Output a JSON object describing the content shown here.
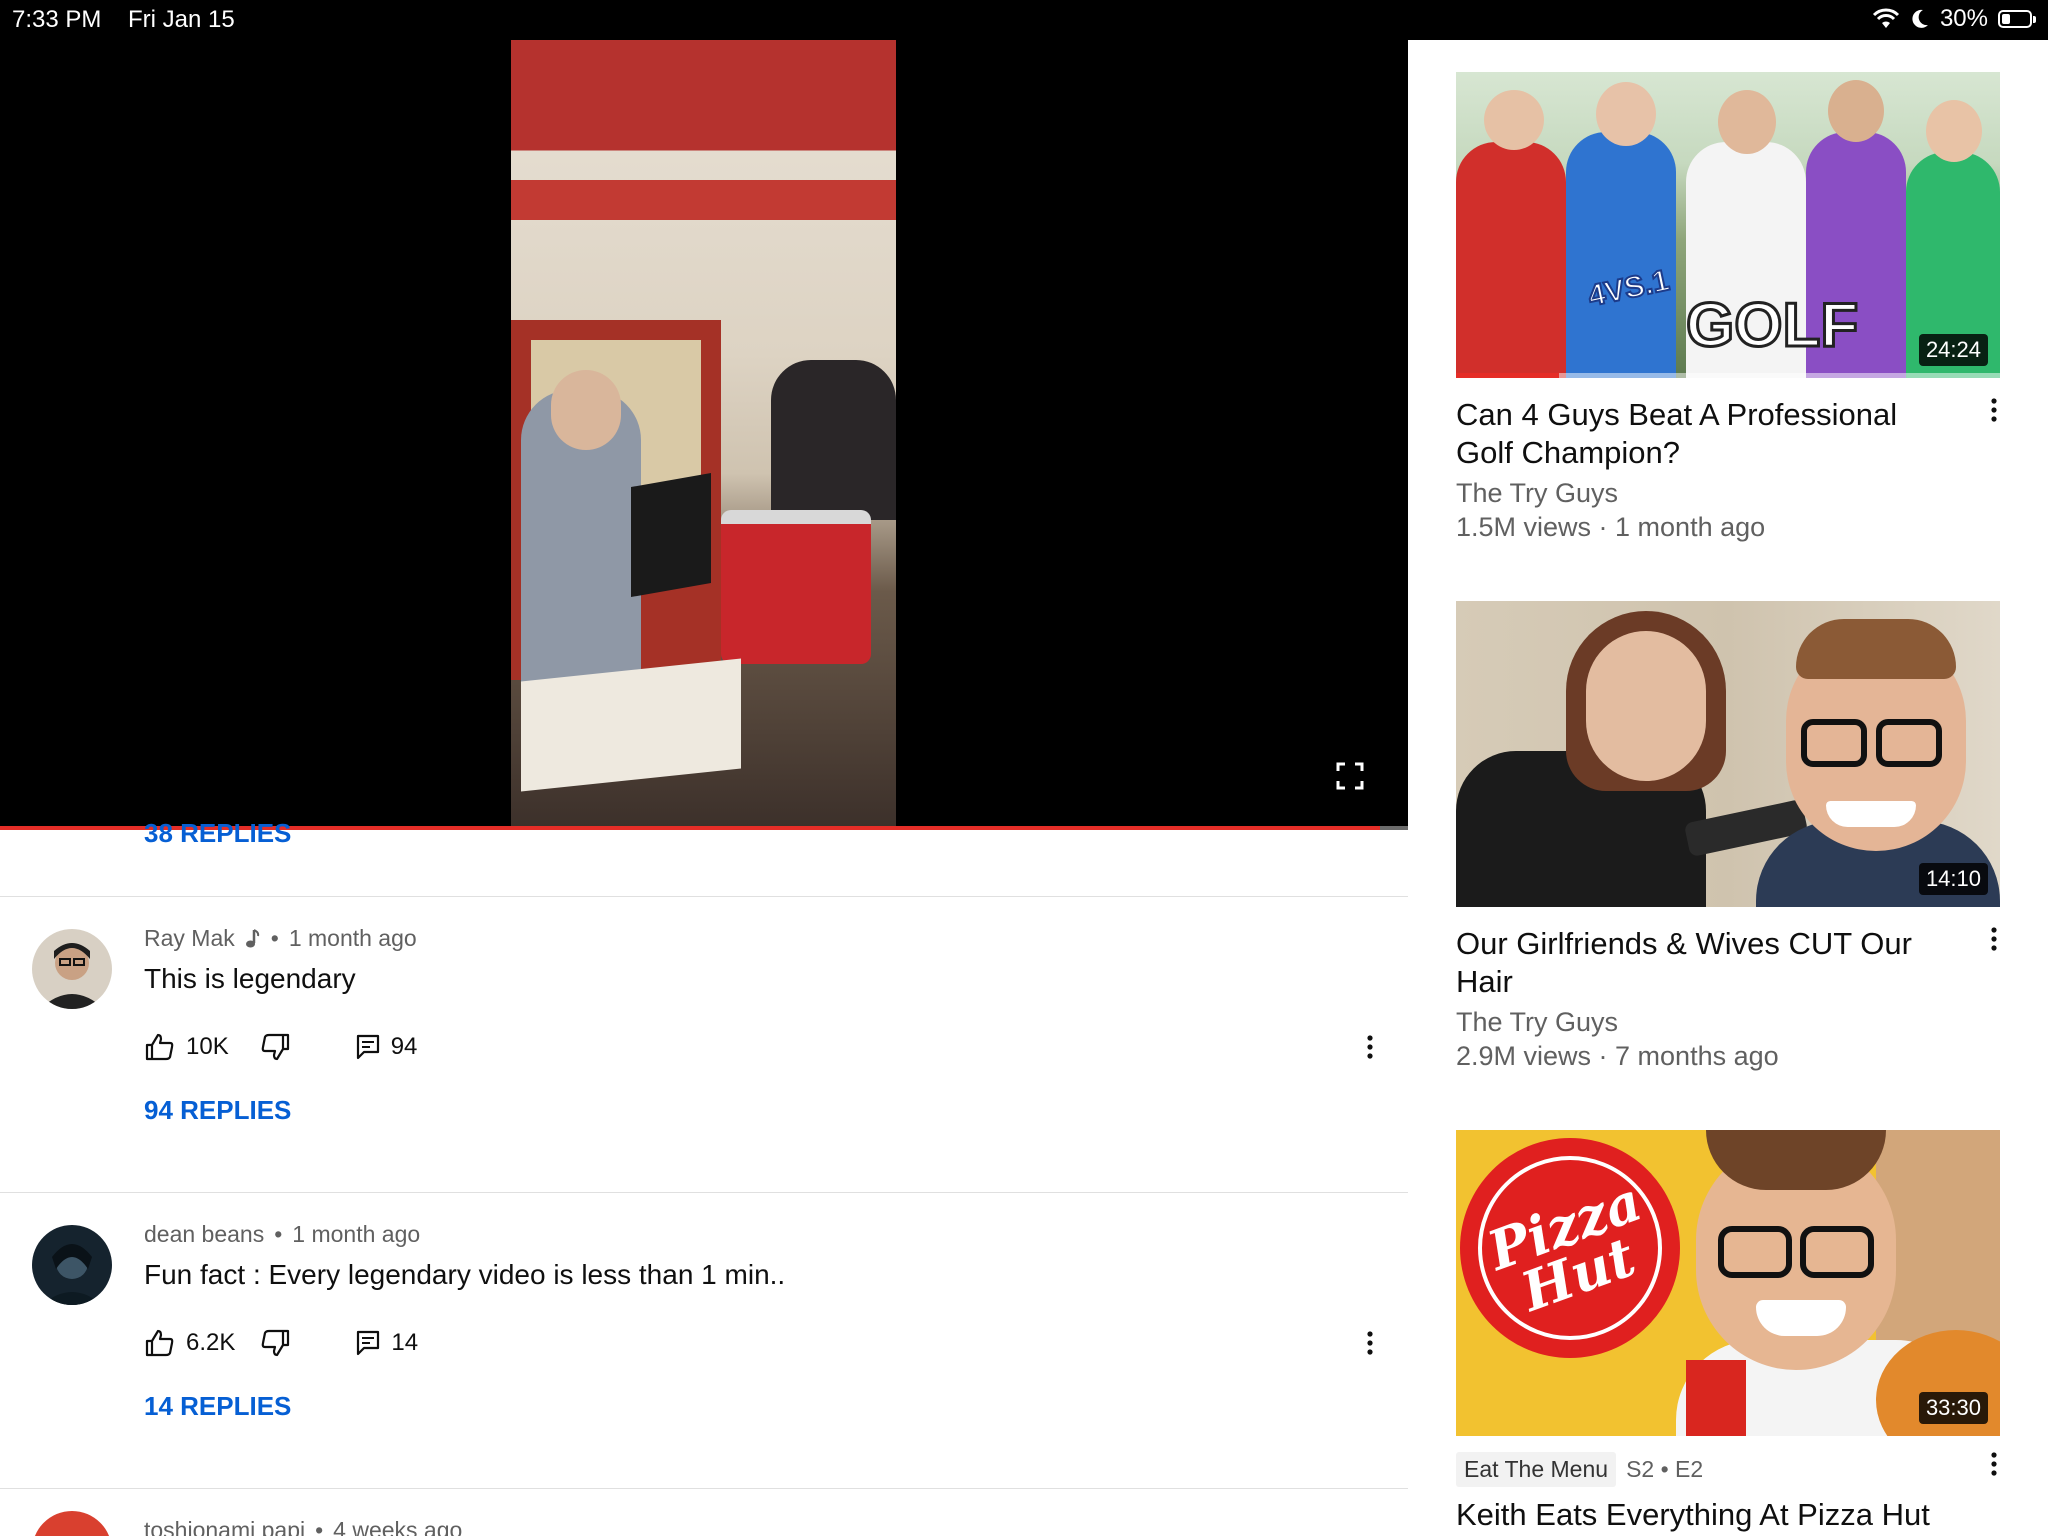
{
  "status_bar": {
    "time": "7:33 PM",
    "date": "Fri Jan 15",
    "battery": "30%",
    "battery_level": 0.3
  },
  "player": {
    "progress": 0.98
  },
  "comments": {
    "previous_replies_label": "38 REPLIES",
    "items": [
      {
        "author": "Ray Mak",
        "age": "1 month ago",
        "text": "This is legendary",
        "likes": "10K",
        "reply_count": "94",
        "replies_label": "94 REPLIES"
      },
      {
        "author": "dean beans",
        "age": "1 month ago",
        "text": "Fun fact : Every legendary video is less than 1 min..",
        "likes": "6.2K",
        "reply_count": "14",
        "replies_label": "14 REPLIES"
      },
      {
        "author": "toshionami papi",
        "age": "4 weeks ago"
      }
    ]
  },
  "recommendations": [
    {
      "title": "Can 4 Guys Beat A Professional Golf Champion?",
      "channel": "The Try Guys",
      "stats": "1.5M views · 1 month ago",
      "duration": "24:24",
      "thumb_text_1": "4VS.1",
      "thumb_text_2": "GOLF",
      "watched_progress": 0.19
    },
    {
      "title": "Our Girlfriends & Wives CUT Our Hair",
      "channel": "The Try Guys",
      "stats": "2.9M views · 7 months ago",
      "duration": "14:10"
    },
    {
      "title": "Keith Eats Everything At Pizza Hut",
      "series": "Eat The Menu",
      "episode": "S2 • E2",
      "duration": "33:30",
      "thumb_logo": "Pizza Hut"
    }
  ],
  "icons": {
    "like": "thumbs-up-icon",
    "dislike": "thumbs-down-icon",
    "reply": "comment-icon",
    "more": "more-vert-icon",
    "fullscreen": "fullscreen-icon",
    "note": "music-note-icon"
  }
}
